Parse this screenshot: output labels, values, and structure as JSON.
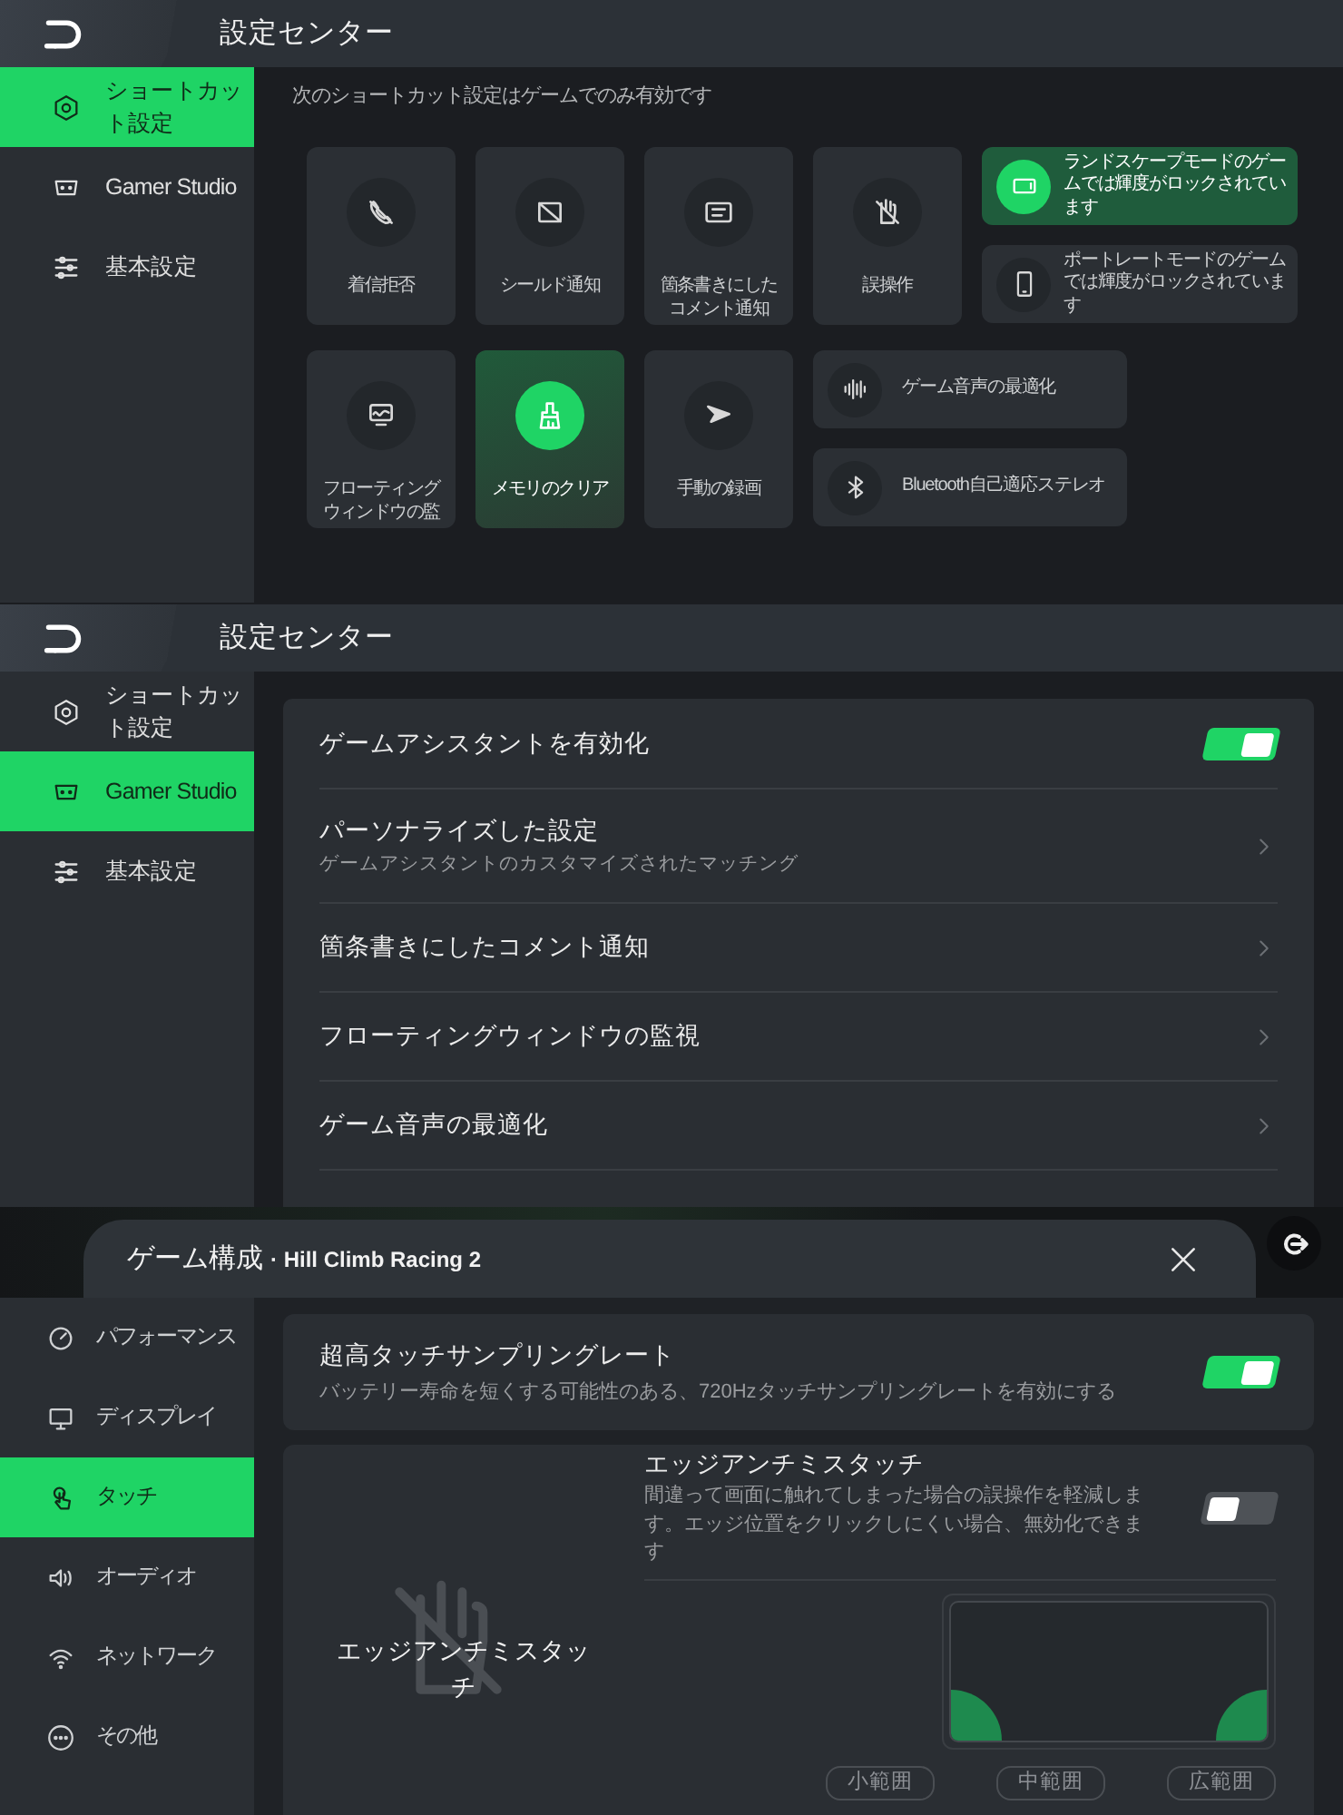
{
  "shortcut_screen": {
    "title": "設定センター",
    "sidebar": [
      {
        "label": "ショートカット設定",
        "selected": true
      },
      {
        "label": "Gamer Studio",
        "selected": false
      },
      {
        "label": "基本設定",
        "selected": false
      }
    ],
    "notice": "次のショートカット設定はゲームでのみ有効です",
    "rows": [
      {
        "tiles": [
          {
            "kind": "square",
            "label": "着信拒否",
            "on": false
          },
          {
            "kind": "square",
            "label": "シールド通知",
            "on": false
          },
          {
            "kind": "square",
            "label": "箇条書きにしたコメント通知",
            "on": false
          },
          {
            "kind": "square",
            "label": "誤操作",
            "on": false
          },
          {
            "kind": "wide",
            "label": "ランドスケープモードのゲームでは輝度がロックされています",
            "on": true
          },
          {
            "kind": "wide",
            "label": "ポートレートモードのゲームでは輝度がロックされています",
            "on": false
          }
        ]
      },
      {
        "tiles": [
          {
            "kind": "square",
            "label": "フローティングウィンドウの監",
            "on": false
          },
          {
            "kind": "square",
            "label": "メモリのクリア",
            "on": true
          },
          {
            "kind": "square",
            "label": "手動の録画",
            "on": false
          },
          {
            "kind": "wide",
            "label": "ゲーム音声の最適化",
            "on": false
          },
          {
            "kind": "wide",
            "label": "Bluetooth自己適応ステレオ",
            "on": false
          }
        ]
      }
    ]
  },
  "studio_screen": {
    "title": "設定センター",
    "sidebar": [
      {
        "label": "ショートカット設定",
        "selected": false
      },
      {
        "label": "Gamer Studio",
        "selected": true
      },
      {
        "label": "基本設定",
        "selected": false
      }
    ],
    "rows": [
      {
        "kind": "toggle",
        "label": "ゲームアシスタントを有効化",
        "on": true
      },
      {
        "kind": "link",
        "label": "パーソナライズした設定",
        "sublabel": "ゲームアシスタントのカスタマイズされたマッチング"
      },
      {
        "kind": "link",
        "label": "箇条書きにしたコメント通知"
      },
      {
        "kind": "link",
        "label": "フローティングウィンドウの監視"
      },
      {
        "kind": "link",
        "label": "ゲーム音声の最適化"
      }
    ]
  },
  "game_config_screen": {
    "title": "ゲーム構成",
    "game": "· Hill Climb Racing 2",
    "sidebar": [
      {
        "label": "パフォーマンス",
        "selected": false
      },
      {
        "label": "ディスプレイ",
        "selected": false
      },
      {
        "label": "タッチ",
        "selected": true
      },
      {
        "label": "オーディオ",
        "selected": false
      },
      {
        "label": "ネットワーク",
        "selected": false
      },
      {
        "label": "その他",
        "selected": false
      }
    ],
    "touch_sampling": {
      "title": "超高タッチサンプリングレート",
      "description": "バッテリー寿命を短くする可能性のある、720Hzタッチサンプリングレートを有効にする",
      "on": true
    },
    "edge_touch": {
      "illustration_label": "エッジアンチミスタッチ",
      "title": "エッジアンチミスタッチ",
      "description": "間違って画面に触れてしまった場合の誤操作を軽減します。エッジ位置をクリックしにくい場合、無効化できます",
      "on": false,
      "ranges": [
        "小範囲",
        "中範囲",
        "広範囲"
      ]
    }
  }
}
